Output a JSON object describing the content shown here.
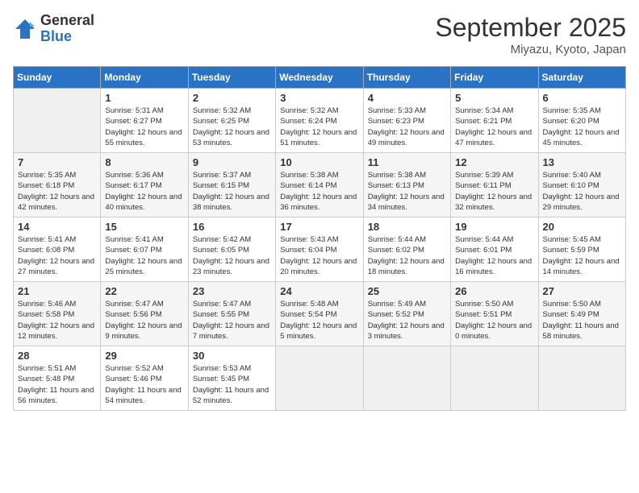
{
  "header": {
    "logo_general": "General",
    "logo_blue": "Blue",
    "month_title": "September 2025",
    "location": "Miyazu, Kyoto, Japan"
  },
  "weekdays": [
    "Sunday",
    "Monday",
    "Tuesday",
    "Wednesday",
    "Thursday",
    "Friday",
    "Saturday"
  ],
  "weeks": [
    [
      {
        "day": null
      },
      {
        "day": "1",
        "sunrise": "5:31 AM",
        "sunset": "6:27 PM",
        "daylight": "12 hours and 55 minutes."
      },
      {
        "day": "2",
        "sunrise": "5:32 AM",
        "sunset": "6:25 PM",
        "daylight": "12 hours and 53 minutes."
      },
      {
        "day": "3",
        "sunrise": "5:32 AM",
        "sunset": "6:24 PM",
        "daylight": "12 hours and 51 minutes."
      },
      {
        "day": "4",
        "sunrise": "5:33 AM",
        "sunset": "6:23 PM",
        "daylight": "12 hours and 49 minutes."
      },
      {
        "day": "5",
        "sunrise": "5:34 AM",
        "sunset": "6:21 PM",
        "daylight": "12 hours and 47 minutes."
      },
      {
        "day": "6",
        "sunrise": "5:35 AM",
        "sunset": "6:20 PM",
        "daylight": "12 hours and 45 minutes."
      }
    ],
    [
      {
        "day": "7",
        "sunrise": "5:35 AM",
        "sunset": "6:18 PM",
        "daylight": "12 hours and 42 minutes."
      },
      {
        "day": "8",
        "sunrise": "5:36 AM",
        "sunset": "6:17 PM",
        "daylight": "12 hours and 40 minutes."
      },
      {
        "day": "9",
        "sunrise": "5:37 AM",
        "sunset": "6:15 PM",
        "daylight": "12 hours and 38 minutes."
      },
      {
        "day": "10",
        "sunrise": "5:38 AM",
        "sunset": "6:14 PM",
        "daylight": "12 hours and 36 minutes."
      },
      {
        "day": "11",
        "sunrise": "5:38 AM",
        "sunset": "6:13 PM",
        "daylight": "12 hours and 34 minutes."
      },
      {
        "day": "12",
        "sunrise": "5:39 AM",
        "sunset": "6:11 PM",
        "daylight": "12 hours and 32 minutes."
      },
      {
        "day": "13",
        "sunrise": "5:40 AM",
        "sunset": "6:10 PM",
        "daylight": "12 hours and 29 minutes."
      }
    ],
    [
      {
        "day": "14",
        "sunrise": "5:41 AM",
        "sunset": "6:08 PM",
        "daylight": "12 hours and 27 minutes."
      },
      {
        "day": "15",
        "sunrise": "5:41 AM",
        "sunset": "6:07 PM",
        "daylight": "12 hours and 25 minutes."
      },
      {
        "day": "16",
        "sunrise": "5:42 AM",
        "sunset": "6:05 PM",
        "daylight": "12 hours and 23 minutes."
      },
      {
        "day": "17",
        "sunrise": "5:43 AM",
        "sunset": "6:04 PM",
        "daylight": "12 hours and 20 minutes."
      },
      {
        "day": "18",
        "sunrise": "5:44 AM",
        "sunset": "6:02 PM",
        "daylight": "12 hours and 18 minutes."
      },
      {
        "day": "19",
        "sunrise": "5:44 AM",
        "sunset": "6:01 PM",
        "daylight": "12 hours and 16 minutes."
      },
      {
        "day": "20",
        "sunrise": "5:45 AM",
        "sunset": "5:59 PM",
        "daylight": "12 hours and 14 minutes."
      }
    ],
    [
      {
        "day": "21",
        "sunrise": "5:46 AM",
        "sunset": "5:58 PM",
        "daylight": "12 hours and 12 minutes."
      },
      {
        "day": "22",
        "sunrise": "5:47 AM",
        "sunset": "5:56 PM",
        "daylight": "12 hours and 9 minutes."
      },
      {
        "day": "23",
        "sunrise": "5:47 AM",
        "sunset": "5:55 PM",
        "daylight": "12 hours and 7 minutes."
      },
      {
        "day": "24",
        "sunrise": "5:48 AM",
        "sunset": "5:54 PM",
        "daylight": "12 hours and 5 minutes."
      },
      {
        "day": "25",
        "sunrise": "5:49 AM",
        "sunset": "5:52 PM",
        "daylight": "12 hours and 3 minutes."
      },
      {
        "day": "26",
        "sunrise": "5:50 AM",
        "sunset": "5:51 PM",
        "daylight": "12 hours and 0 minutes."
      },
      {
        "day": "27",
        "sunrise": "5:50 AM",
        "sunset": "5:49 PM",
        "daylight": "11 hours and 58 minutes."
      }
    ],
    [
      {
        "day": "28",
        "sunrise": "5:51 AM",
        "sunset": "5:48 PM",
        "daylight": "11 hours and 56 minutes."
      },
      {
        "day": "29",
        "sunrise": "5:52 AM",
        "sunset": "5:46 PM",
        "daylight": "11 hours and 54 minutes."
      },
      {
        "day": "30",
        "sunrise": "5:53 AM",
        "sunset": "5:45 PM",
        "daylight": "11 hours and 52 minutes."
      },
      {
        "day": null
      },
      {
        "day": null
      },
      {
        "day": null
      },
      {
        "day": null
      }
    ]
  ]
}
